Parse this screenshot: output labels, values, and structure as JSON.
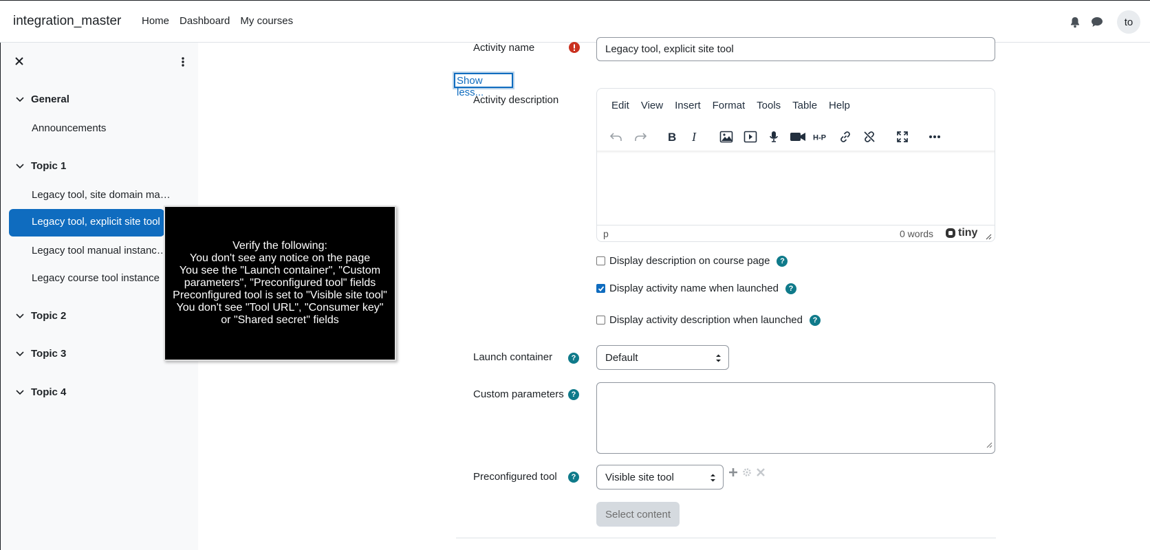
{
  "navbar": {
    "brand": "integration_master",
    "links": [
      "Home",
      "Dashboard",
      "My courses"
    ],
    "avatar_initials": "to"
  },
  "drawer": {
    "sections": [
      {
        "label": "General",
        "items": [
          "Announcements"
        ]
      },
      {
        "label": "Topic 1",
        "items": [
          "Legacy tool, site domain ma…",
          "Legacy tool, explicit site tool",
          "Legacy tool manual instanc…",
          "Legacy course tool instance"
        ]
      },
      {
        "label": "Topic 2",
        "items": []
      },
      {
        "label": "Topic 3",
        "items": []
      },
      {
        "label": "Topic 4",
        "items": []
      }
    ],
    "active_item": "Legacy tool, explicit site tool"
  },
  "overlay": {
    "lines": [
      "Verify the following:",
      "You don't see any notice on the page",
      "You see the \"Launch container\", \"Custom",
      "parameters\", \"Preconfigured tool\" fields",
      "Preconfigured tool is set to \"Visible site tool\"",
      "You don't see \"Tool URL\", \"Consumer key\"",
      "or \"Shared secret\" fields"
    ]
  },
  "form": {
    "activity_name_label": "Activity name",
    "activity_name_value": "Legacy tool, explicit site tool",
    "show_less": "Show less...",
    "activity_description_label": "Activity description",
    "editor": {
      "menu": [
        "Edit",
        "View",
        "Insert",
        "Format",
        "Tools",
        "Table",
        "Help"
      ],
      "status_element": "p",
      "word_count": "0 words",
      "brand": "tiny"
    },
    "checkboxes": [
      {
        "label": "Display description on course page",
        "checked": false
      },
      {
        "label": "Display activity name when launched",
        "checked": true
      },
      {
        "label": "Display activity description when launched",
        "checked": false
      }
    ],
    "launch_container_label": "Launch container",
    "launch_container_value": "Default",
    "custom_parameters_label": "Custom parameters",
    "preconfigured_tool_label": "Preconfigured tool",
    "preconfigured_tool_value": "Visible site tool",
    "select_content_label": "Select content"
  },
  "colors": {
    "primary": "#0f6cbf",
    "help": "#0f7a8a",
    "required": "#ca3120"
  }
}
